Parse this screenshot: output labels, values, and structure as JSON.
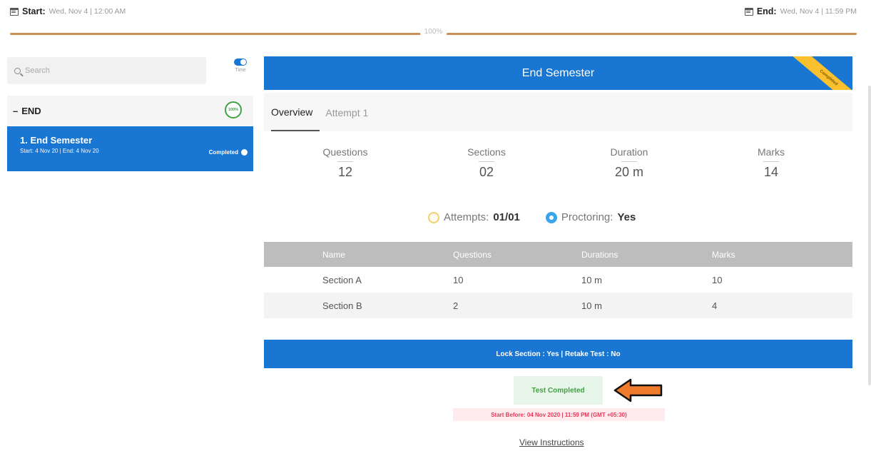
{
  "schedule": {
    "start_label": "Start:",
    "start_value": "Wed, Nov 4 | 12:00 AM",
    "end_label": "End:",
    "end_value": "Wed, Nov 4 | 11:59 PM",
    "progress_label": "100%",
    "progress_fraction": 1.0
  },
  "sidebar": {
    "search_placeholder": "Search",
    "toggle_label": "Time",
    "group": {
      "prefix": "–",
      "name": "END",
      "progress_label": "100%"
    },
    "items": [
      {
        "title": "1. End Semester",
        "dates": "Start: 4 Nov 20 | End: 4 Nov 20",
        "status": "Completed"
      }
    ]
  },
  "main": {
    "title": "End Semester",
    "ribbon": "Completed",
    "tabs": [
      {
        "label": "Overview",
        "active": true
      },
      {
        "label": "Attempt 1",
        "active": false
      }
    ],
    "stats": [
      {
        "label": "Questions",
        "value": "12"
      },
      {
        "label": "Sections",
        "value": "02"
      },
      {
        "label": "Duration",
        "value": "20 m"
      },
      {
        "label": "Marks",
        "value": "14"
      }
    ],
    "attempts_label": "Attempts:",
    "attempts_value": "01/01",
    "proctoring_label": "Proctoring:",
    "proctoring_value": "Yes",
    "table": {
      "headers": [
        "Name",
        "Questions",
        "Durations",
        "Marks"
      ],
      "rows": [
        [
          "Section A",
          "10",
          "10 m",
          "10"
        ],
        [
          "Section B",
          "2",
          "10 m",
          "4"
        ]
      ]
    },
    "lock_info": "Lock Section : Yes | Retake Test : No",
    "status_button": "Test Completed",
    "start_before": "Start Before: 04 Nov 2020 | 11:59 PM (GMT +05:30)",
    "view_instructions": "View Instructions"
  },
  "colors": {
    "primary": "#1976d2",
    "progress": "#c99155",
    "success": "#43a047",
    "danger": "#e53958",
    "arrow": "#ef7b2d"
  }
}
